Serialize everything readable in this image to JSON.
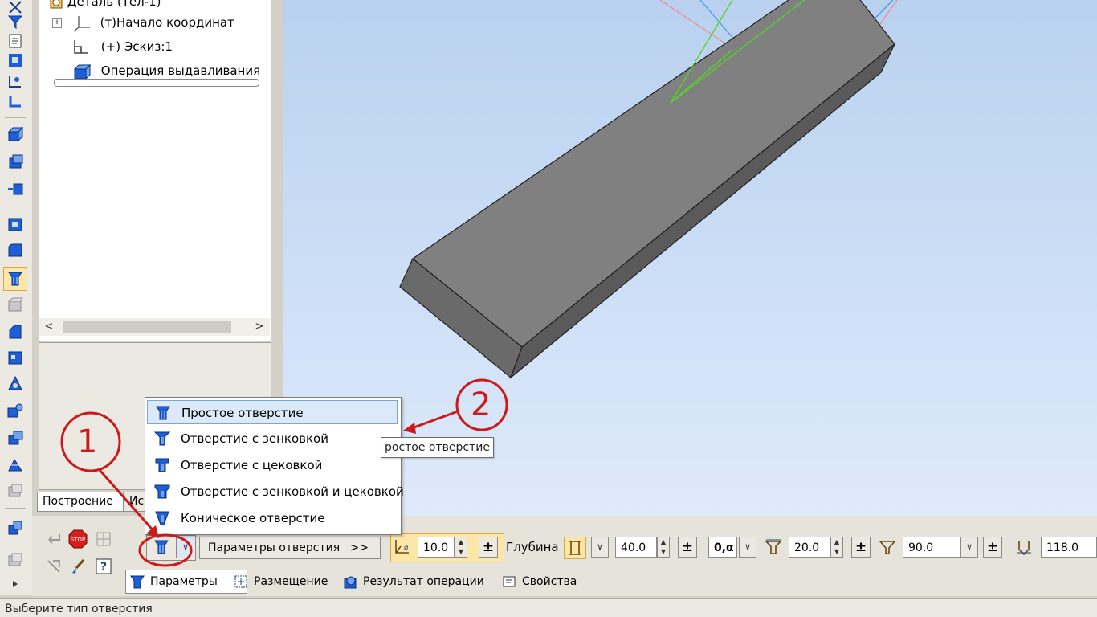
{
  "tree": {
    "root_label": "Деталь (Тел-1)",
    "items": [
      {
        "label": "(т)Начало координат"
      },
      {
        "label": "(+) Эскиз:1"
      },
      {
        "label": "Операция выдавливания"
      }
    ],
    "tabs": [
      "Построение",
      "Ис"
    ]
  },
  "hole_menu": {
    "items": [
      {
        "label": "Простое отверстие",
        "highlighted": true
      },
      {
        "label": "Отверстие с зенковкой"
      },
      {
        "label": "Отверстие с цековкой"
      },
      {
        "label": "Отверстие с зенковкой и цековкой"
      },
      {
        "label": "Коническое отверстие"
      }
    ],
    "tooltip": "ростое отверстие"
  },
  "annotations": {
    "marker1": "1",
    "marker2": "2",
    "color": "#cc1a1a"
  },
  "prop_bar": {
    "params_button": "Параметры отверстия",
    "params_chevron": ">>",
    "diameter_value": "10.0",
    "depth_label": "Глубина",
    "depth_value": "40.0",
    "mode_value": "0,α",
    "countersink_value": "20.0",
    "angle_value": "90.0",
    "tip_angle_value": "118.0",
    "tabs": [
      {
        "label": "Параметры"
      },
      {
        "label": "Размещение"
      },
      {
        "label": "Результат операции"
      },
      {
        "label": "Свойства"
      }
    ]
  },
  "status": {
    "text": "Выберите тип отверстия"
  },
  "colors": {
    "viewport_top": "#b9d1ef",
    "body_top": "#808080",
    "body_side": "#5f5f5f",
    "sketch_green": "#56d22a",
    "axis_blue": "#3b9ae6",
    "axis_red": "#f08a8a",
    "icon_blue": "#1e5fd8"
  }
}
